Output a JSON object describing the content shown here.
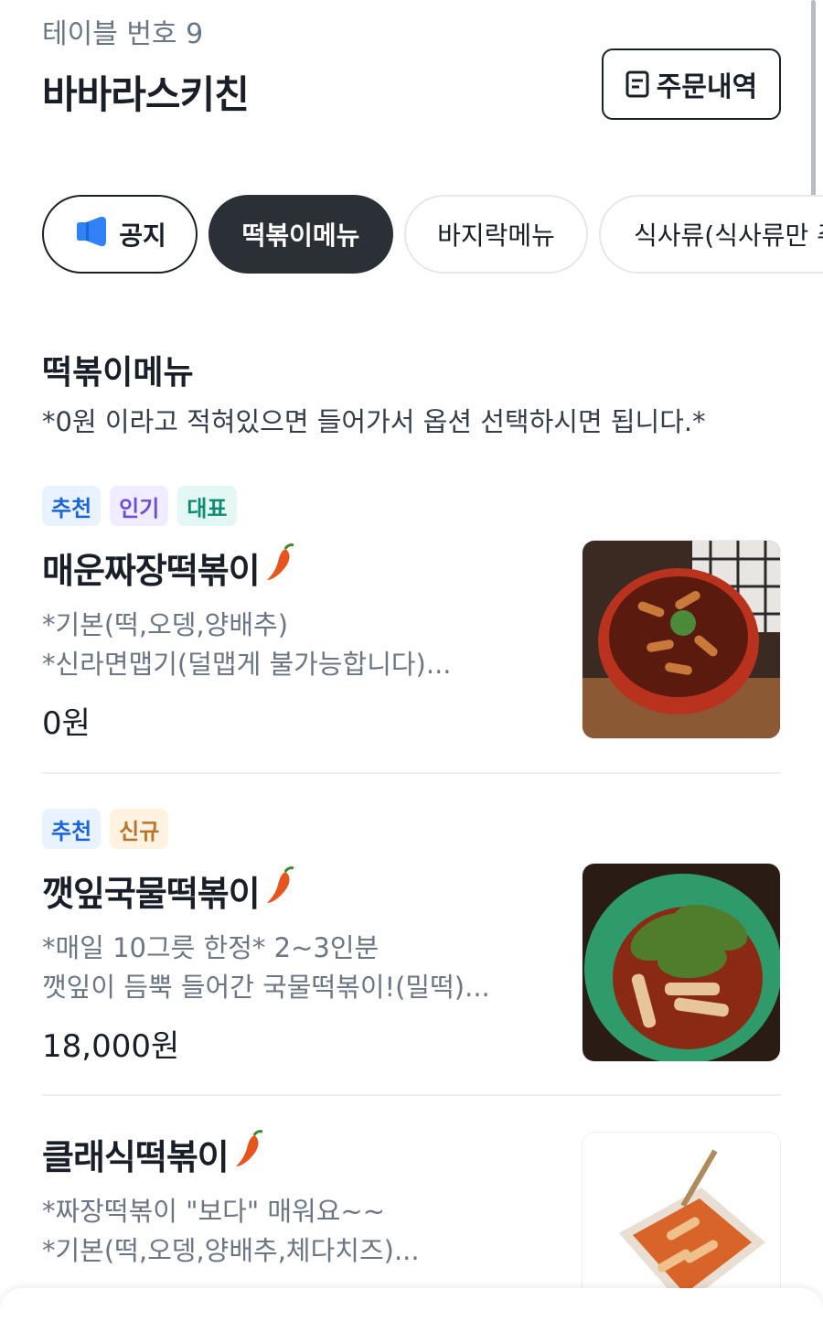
{
  "header": {
    "table_label": "테이블 번호 9",
    "store_name": "바바라스키친",
    "order_history_label": "주문내역"
  },
  "tabs": [
    {
      "label": "공지",
      "icon": "megaphone-icon"
    },
    {
      "label": "떡볶이메뉴",
      "active": true
    },
    {
      "label": "바지락메뉴"
    },
    {
      "label": "식사류(식사류만 주"
    }
  ],
  "section": {
    "title": "떡볶이메뉴",
    "description": "*0원 이라고 적혀있으면 들어가서 옵션 선택하시면 됩니다.*"
  },
  "menu_items": [
    {
      "badges": [
        "추천",
        "인기",
        "대표"
      ],
      "name": "매운짜장떡볶이",
      "icon": "chili-pepper-icon",
      "desc_lines": [
        "*기본(떡,오뎅,양배추)",
        "*신라면맵기(덜맵게 불가능합니다)..."
      ],
      "price": "0원"
    },
    {
      "badges": [
        "추천",
        "신규"
      ],
      "name": "깻잎국물떡볶이",
      "icon": "chili-pepper-icon",
      "desc_lines": [
        "*매일 10그릇 한정* 2~3인분",
        "깻잎이 듬뿍 들어간 국물떡볶이!(밀떡)..."
      ],
      "price": "18,000원"
    },
    {
      "badges": [],
      "name": "클래식떡볶이",
      "icon": "chili-pepper-icon",
      "desc_lines": [
        "*짜장떡볶이 \"보다\" 매워요~~",
        "*기본(떡,오뎅,양배추,체다치즈)..."
      ],
      "price": ""
    }
  ],
  "colors": {
    "badge_recommend_bg": "#e8f3ff",
    "badge_recommend_fg": "#1b64da",
    "badge_popular_bg": "#f1ecff",
    "badge_popular_fg": "#6b4fd8",
    "badge_signature_bg": "#e3f8f4",
    "badge_signature_fg": "#0f8a73",
    "badge_new_bg": "#fff2e1",
    "badge_new_fg": "#b8742a",
    "active_tab": "#2b2f36",
    "megaphone": "#3182f6",
    "chili": "#e8541e"
  }
}
